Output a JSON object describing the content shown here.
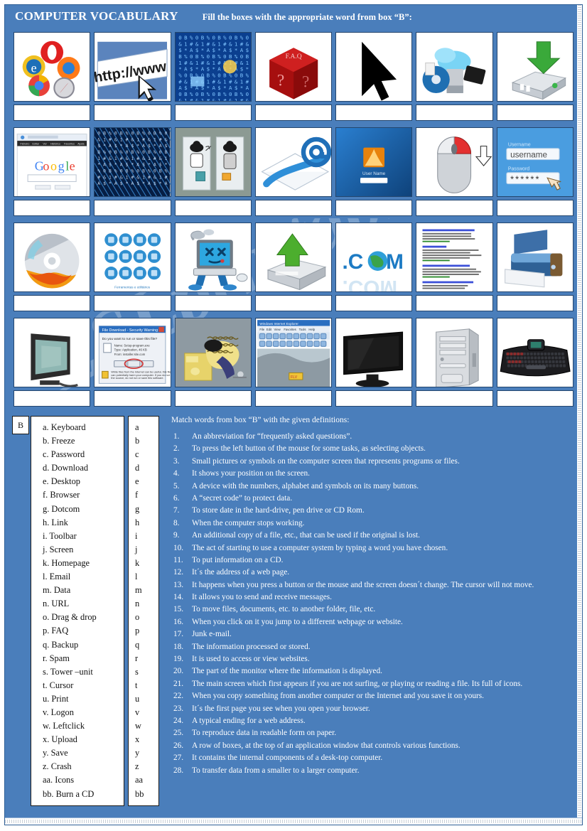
{
  "header": {
    "title": "COMPUTER VOCABULARY",
    "instruction": "Fill the boxes with the appropriate word from box “B”:"
  },
  "colors": {
    "background": "#4a7ebb",
    "cell_background": "#ffffff",
    "cell_border": "#24466e",
    "text_on_blue": "#ffffff",
    "text_on_white": "#111111"
  },
  "grid": {
    "rows": 4,
    "columns": 7,
    "answer_box_value": "",
    "cells": [
      [
        {
          "icon": "web-browsers-icon",
          "caption": ""
        },
        {
          "icon": "http-www-address-bar-icon",
          "caption": ""
        },
        {
          "icon": "binary-data-screen-icon",
          "caption": ""
        },
        {
          "icon": "faq-dice-icon",
          "caption": ""
        },
        {
          "icon": "mouse-cursor-arrow-icon",
          "caption": ""
        },
        {
          "icon": "cd-media-burn-icon",
          "caption": ""
        },
        {
          "icon": "download-to-drive-icon",
          "caption": ""
        }
      ],
      [
        {
          "icon": "google-homepage-icon",
          "caption": ""
        },
        {
          "icon": "binary-code-matrix-icon",
          "caption": ""
        },
        {
          "icon": "drag-and-drop-paperdoll-icon",
          "caption": ""
        },
        {
          "icon": "email-envelope-at-icon",
          "caption": ""
        },
        {
          "icon": "logon-user-screen-icon",
          "caption": ""
        },
        {
          "icon": "mouse-leftclick-icon",
          "caption": ""
        },
        {
          "icon": "password-login-form-icon",
          "caption": ""
        }
      ],
      [
        {
          "icon": "burning-cd-icon",
          "caption": ""
        },
        {
          "icon": "desktop-icons-set-icon",
          "caption": ""
        },
        {
          "icon": "crashed-computer-icon",
          "caption": ""
        },
        {
          "icon": "upload-from-drive-icon",
          "caption": ""
        },
        {
          "icon": "dotcom-globe-icon",
          "caption": ""
        },
        {
          "icon": "search-results-links-icon",
          "caption": ""
        },
        {
          "icon": "printer-icon",
          "caption": ""
        }
      ],
      [
        {
          "icon": "crt-screen-icon",
          "caption": ""
        },
        {
          "icon": "download-dialog-icon",
          "caption": ""
        },
        {
          "icon": "spam-junk-mail-icon",
          "caption": ""
        },
        {
          "icon": "browser-toolbar-icon",
          "caption": ""
        },
        {
          "icon": "flat-monitor-icon",
          "caption": ""
        },
        {
          "icon": "tower-unit-icon",
          "caption": ""
        },
        {
          "icon": "keyboard-icon",
          "caption": ""
        }
      ]
    ]
  },
  "box_b": {
    "label": "B",
    "words": [
      "a. Keyboard",
      "b. Freeze",
      "c. Password",
      "d. Download",
      "e. Desktop",
      "f. Browser",
      "g. Dotcom",
      "h. Link",
      "i. Toolbar",
      "j. Screen",
      "k. Homepage",
      "l. Email",
      "m. Data",
      "n. URL",
      "o. Drag & drop",
      "p. FAQ",
      "q. Backup",
      "r. Spam",
      "s. Tower –unit",
      "t. Cursor",
      "u. Print",
      "v. Logon",
      "w. Leftclick",
      "x. Upload",
      "y. Save",
      "z. Crash",
      "aa. Icons",
      "bb. Burn a CD"
    ],
    "answer_letters": [
      "a",
      "b",
      "c",
      "d",
      "e",
      "f",
      "g",
      "h",
      "i",
      "j",
      "k",
      "l",
      "m",
      "n",
      "o",
      "p",
      "q",
      "r",
      "s",
      "t",
      "u",
      "v",
      "w",
      "x",
      "y",
      "z",
      "aa",
      "bb"
    ],
    "answer_values": [
      "",
      "",
      "",
      "",
      "",
      "",
      "",
      "",
      "",
      "",
      "",
      "",
      "",
      "",
      "",
      "",
      "",
      "",
      "",
      "",
      "",
      "",
      "",
      "",
      "",
      "",
      "",
      ""
    ]
  },
  "definitions": {
    "heading": "Match words from box “B” with the given definitions:",
    "items": [
      {
        "num": "1.",
        "text": "An abbreviation for “frequently asked questions”."
      },
      {
        "num": "2.",
        "text": "To press the left button of the mouse for some tasks, as selecting objects."
      },
      {
        "num": "3.",
        "text": "Small pictures or symbols on the computer screen that represents programs or files."
      },
      {
        "num": "4.",
        "text": "It shows your position on the screen."
      },
      {
        "num": "5.",
        "text": "A device with the numbers, alphabet and symbols on its many buttons."
      },
      {
        "num": "6.",
        "text": "A “secret code” to protect data."
      },
      {
        "num": "7.",
        "text": "To store date in the hard-drive, pen drive or CD Rom."
      },
      {
        "num": "8.",
        "text": "When the computer stops working."
      },
      {
        "num": "9.",
        "text": "An additional copy of a file, etc., that can be used if the original is lost."
      },
      {
        "num": "10.",
        "text": "The act of starting to use a computer system by typing a word you have chosen."
      },
      {
        "num": "11.",
        "text": "To put information on a CD."
      },
      {
        "num": "12.",
        "text": "It´s the address of a web page."
      },
      {
        "num": "13.",
        "text": "It happens when you press a button or the mouse and the screen doesn´t change. The cursor will not move."
      },
      {
        "num": "14.",
        "text": "It allows you to send and receive messages."
      },
      {
        "num": "15.",
        "text": "To move files, documents, etc. to another folder, file,  etc."
      },
      {
        "num": "16.",
        "text": "When you click on it you jump to a different webpage or website."
      },
      {
        "num": "17.",
        "text": "Junk e-mail."
      },
      {
        "num": "18.",
        "text": "The information processed or stored."
      },
      {
        "num": "19.",
        "text": "It is used to access or view websites."
      },
      {
        "num": "20.",
        "text": "The part of the monitor where the information is displayed."
      },
      {
        "num": "21.",
        "text": "The main screen which first appears  if you are not surfing, or playing or reading a file. Its full of icons."
      },
      {
        "num": "22.",
        "text": "When you copy something from another computer or the Internet and you save it on yours."
      },
      {
        "num": "23.",
        "text": "It´s the first page you see when you open your browser."
      },
      {
        "num": "24.",
        "text": "A typical ending for a web address."
      },
      {
        "num": "25.",
        "text": "To reproduce data in readable form on paper."
      },
      {
        "num": "26.",
        "text": "A row of boxes, at the top of an application window that controls various functions."
      },
      {
        "num": "27.",
        "text": "It contains the internal components of a desk-top computer."
      },
      {
        "num": "28.",
        "text": "To transfer  data from a smaller to a larger computer."
      }
    ]
  },
  "watermark": {
    "text": "ESLprintables.com"
  }
}
